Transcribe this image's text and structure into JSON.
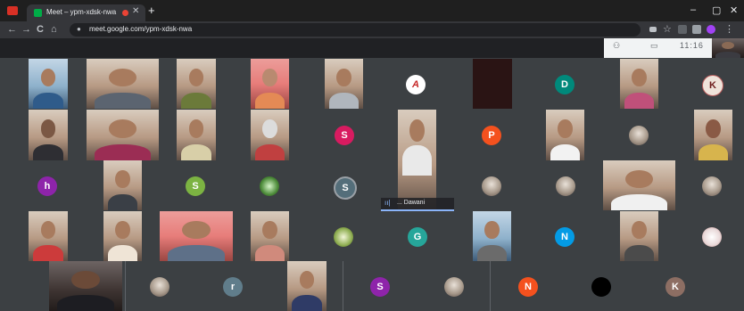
{
  "browser": {
    "tab_title": "Meet – ypm-xdsk-nwa",
    "close_glyph": "✕",
    "new_tab_glyph": "+",
    "url": "meet.google.com/ypm-xdsk-nwa",
    "nav": {
      "back": "←",
      "forward": "→",
      "reload": "C",
      "home": "⌂"
    },
    "window": {
      "minimize": "–",
      "maximize": "▢",
      "close": "✕"
    }
  },
  "meet_controls": {
    "time": "11:16",
    "people_icon": "⚇",
    "chat_icon": "▭"
  },
  "speaker": {
    "name": "... Dawani",
    "icon": "ıı|"
  },
  "avatars": {
    "a1": "A",
    "d1": "D",
    "k1": "K",
    "s1": "S",
    "p1": "P",
    "h1": "h",
    "s2": "S",
    "s3": "S",
    "g1": "G",
    "n1": "N",
    "r1": "r",
    "s4": "S",
    "n2": "N",
    "k2": "K"
  },
  "colors": {
    "s1": "#d81b60",
    "p1": "#f4511e",
    "h1": "#8e24aa",
    "s2": "#7cb342",
    "s3": "#546e7a",
    "g1": "#26a69a",
    "n1": "#039be5",
    "r1": "#607d8b",
    "s4": "#8e24aa",
    "n2": "#f4511e",
    "k2": "#8d6e63",
    "d1": "#00897b"
  }
}
